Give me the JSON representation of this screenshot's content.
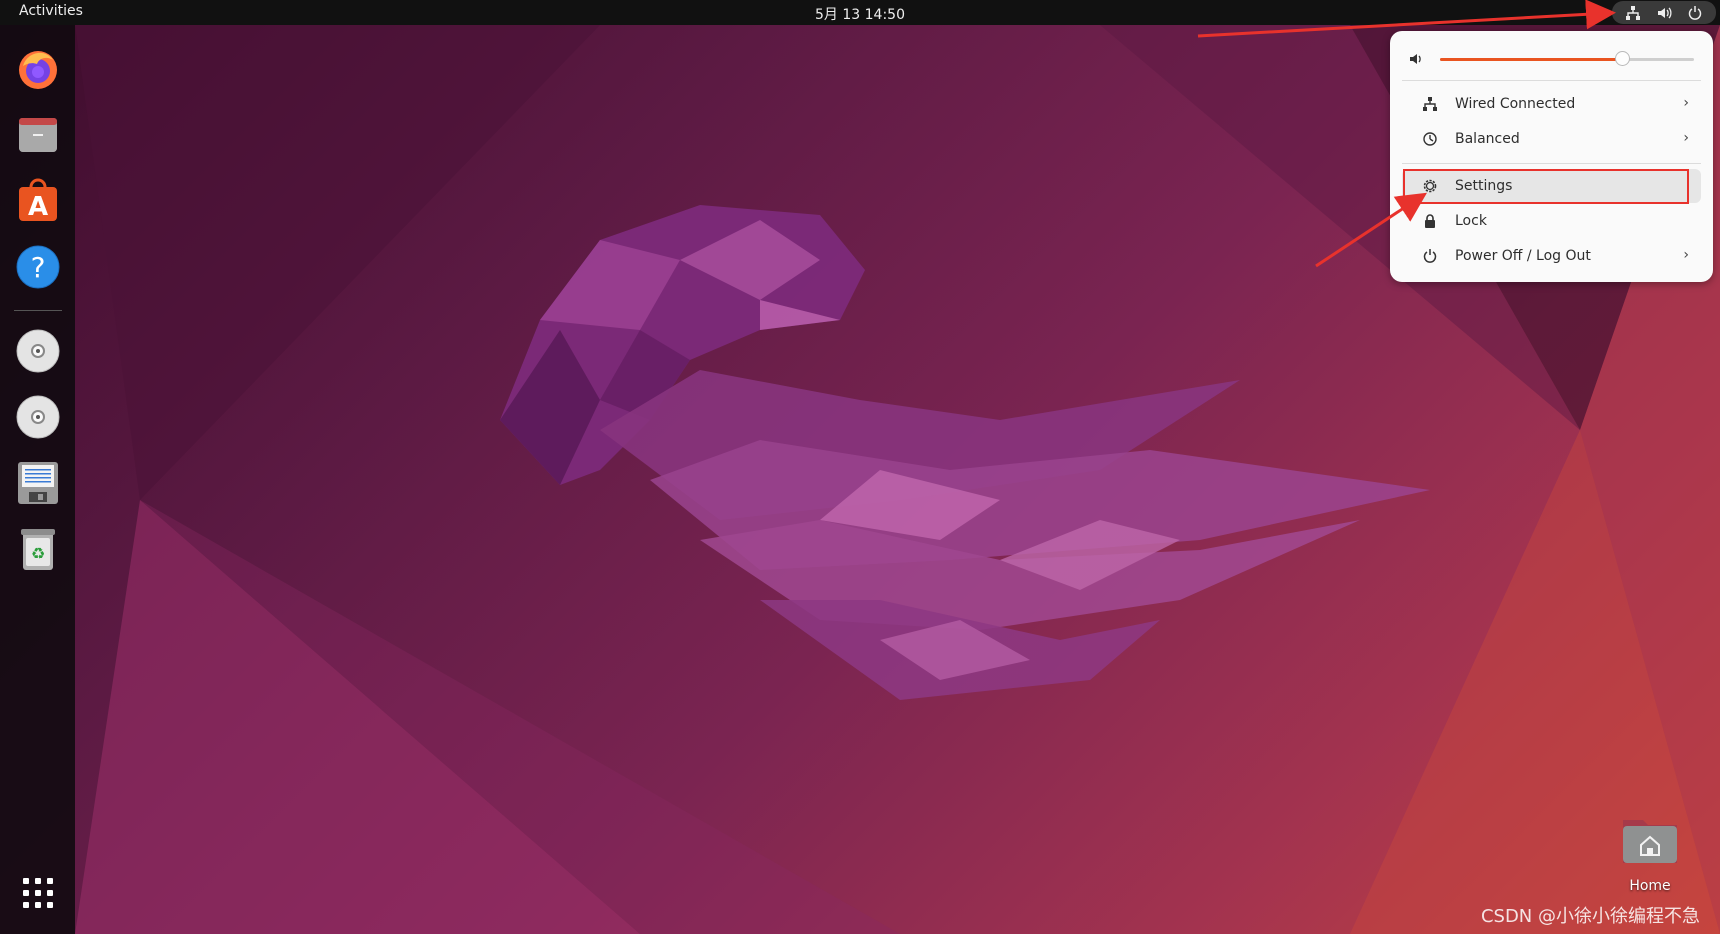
{
  "topbar": {
    "activities_label": "Activities",
    "datetime": "5月 13  14:50",
    "tray_icons": [
      "network-wired-icon",
      "volume-icon",
      "power-icon"
    ]
  },
  "dock": {
    "items": [
      {
        "name": "Firefox",
        "icon": "firefox-icon"
      },
      {
        "name": "Files",
        "icon": "files-icon"
      },
      {
        "name": "Ubuntu Software",
        "icon": "software-center-icon"
      },
      {
        "name": "Help",
        "icon": "help-icon"
      },
      {
        "name": "Disc 1",
        "icon": "optical-disc-icon"
      },
      {
        "name": "Disc 2",
        "icon": "optical-disc-icon"
      },
      {
        "name": "Floppy",
        "icon": "floppy-icon"
      },
      {
        "name": "Trash",
        "icon": "trash-icon"
      },
      {
        "name": "Show Applications",
        "icon": "app-grid-icon"
      }
    ]
  },
  "system_menu": {
    "volume_level": 0.72,
    "items": [
      {
        "label": "Wired Connected",
        "icon": "network-wired-icon",
        "has_submenu": true
      },
      {
        "label": "Balanced",
        "icon": "power-profile-icon",
        "has_submenu": true
      },
      {
        "label": "Settings",
        "icon": "gear-icon",
        "has_submenu": false,
        "highlighted": true
      },
      {
        "label": "Lock",
        "icon": "lock-icon",
        "has_submenu": false
      },
      {
        "label": "Power Off / Log Out",
        "icon": "power-icon",
        "has_submenu": true
      }
    ],
    "chevron": "›"
  },
  "desktop": {
    "home_label": "Home"
  },
  "watermark": "CSDN @小徐小徐编程不急",
  "colors": {
    "accent": "#e95420",
    "annotation": "#e8322c",
    "topbar": "#111111",
    "menu_bg": "#fafafa"
  }
}
